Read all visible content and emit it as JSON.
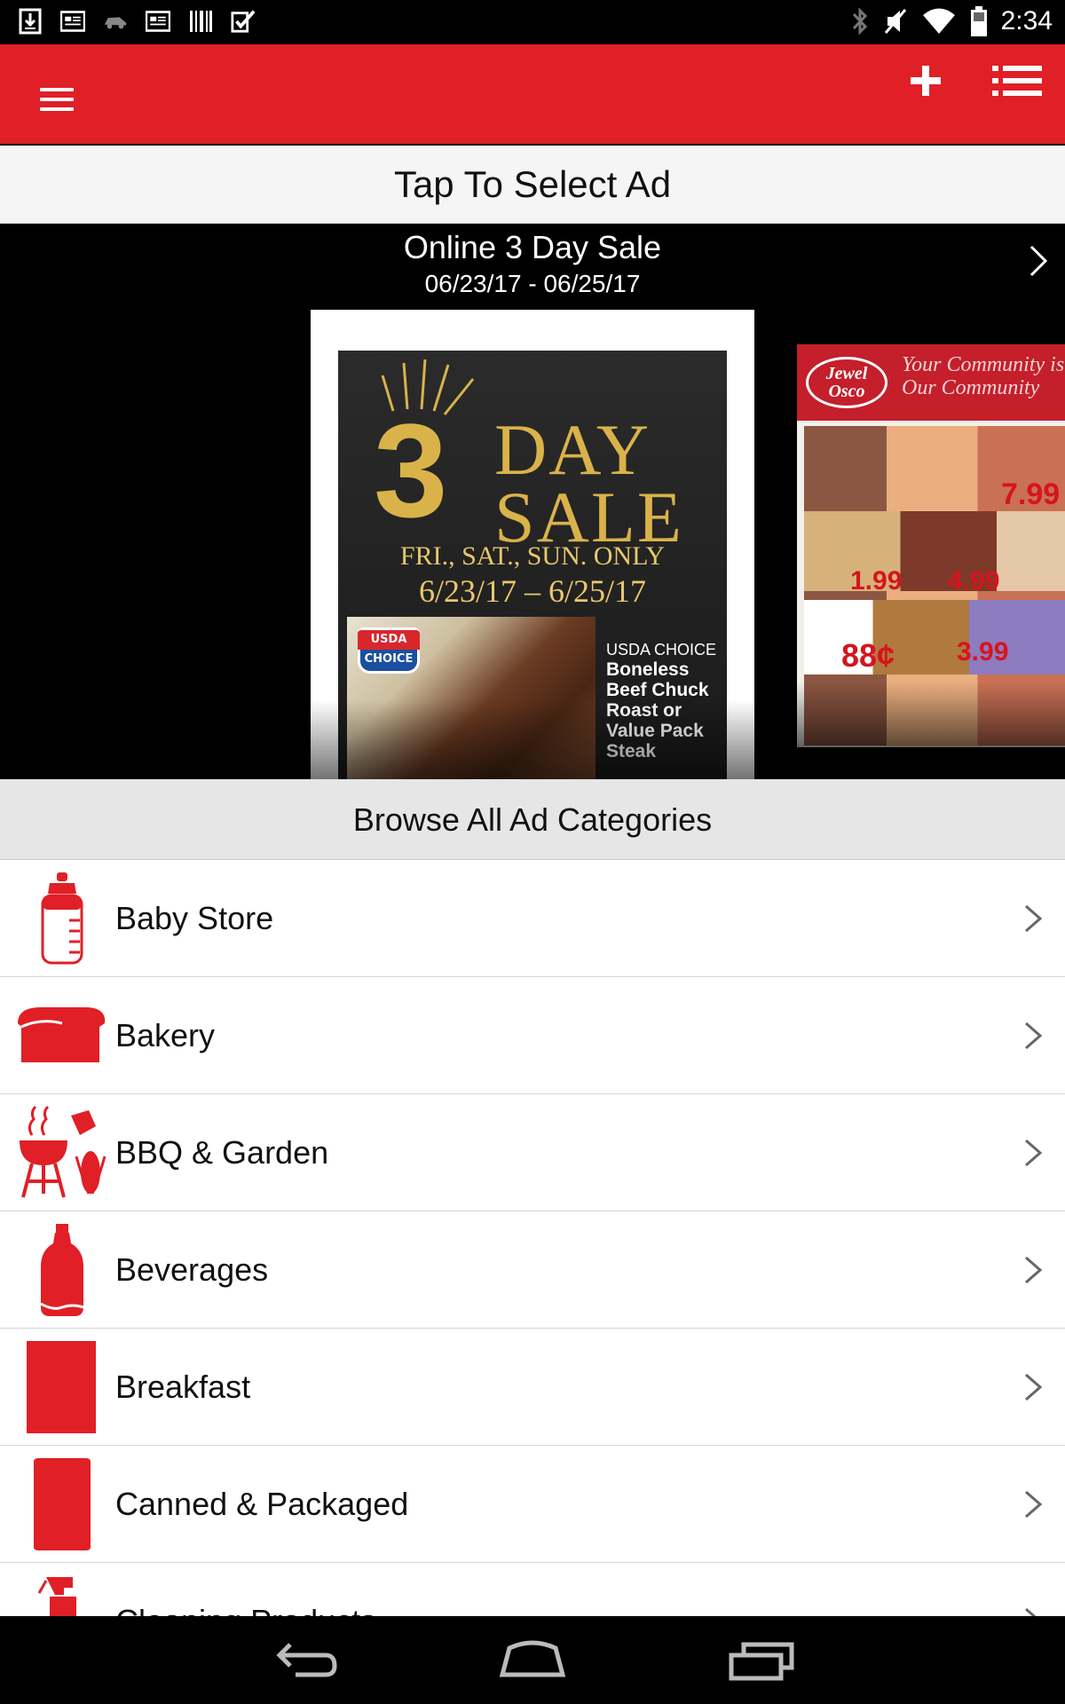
{
  "status_bar": {
    "time": "2:34",
    "left_icons": [
      "download-icon",
      "news-icon",
      "car-icon",
      "news-icon",
      "barcode-icon",
      "check-icon"
    ],
    "right_icons": [
      "bluetooth-icon",
      "mute-icon",
      "wifi-icon",
      "battery-icon"
    ]
  },
  "app_bar": {
    "color": "#e01f26",
    "icons": [
      "menu-icon",
      "plus-icon",
      "list-icon"
    ]
  },
  "select_header": {
    "title": "Tap To Select Ad"
  },
  "ad": {
    "title": "Online 3 Day Sale",
    "dates": "06/23/17 - 06/25/17",
    "cover": {
      "three": "3",
      "day": "DAY",
      "sale": "SALE",
      "days_line": "FRI., SAT., SUN. ONLY",
      "dates_line": "6/23/17 – 6/25/17",
      "badge_top": "USDA",
      "badge_bottom": "CHOICE",
      "meat_label_1": "USDA CHOICE",
      "meat_label_2": "Boneless Beef Chuck Roast or Value Pack Steak"
    },
    "next_cover": {
      "logo": "Jewel Osco",
      "tagline": "Your Community is Our Community",
      "price_1": "7.99",
      "price_2": "1.99",
      "price_3": "4.99",
      "price_4": "88¢",
      "price_5": "3.99"
    }
  },
  "browse_header": {
    "title": "Browse All Ad Categories"
  },
  "categories": [
    {
      "label": "Baby Store",
      "icon": "baby-bottle-icon"
    },
    {
      "label": "Bakery",
      "icon": "bread-icon"
    },
    {
      "label": "BBQ & Garden",
      "icon": "grill-icon"
    },
    {
      "label": "Beverages",
      "icon": "soda-bottle-icon"
    },
    {
      "label": "Breakfast",
      "icon": "cereal-box-icon"
    },
    {
      "label": "Canned & Packaged",
      "icon": "can-icon"
    },
    {
      "label": "Cleaning Products",
      "icon": "spray-bottle-icon"
    }
  ],
  "nav_bar": {
    "icons": [
      "back-icon",
      "home-icon",
      "recents-icon"
    ]
  }
}
